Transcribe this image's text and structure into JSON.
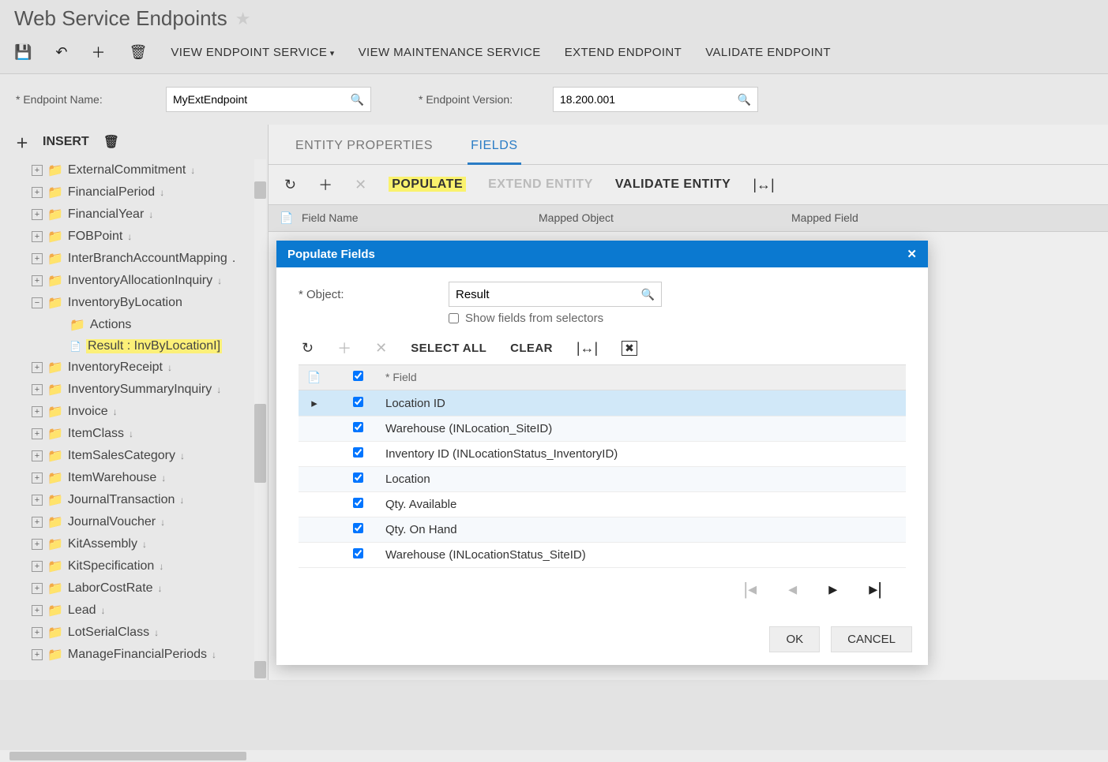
{
  "header": {
    "title": "Web Service Endpoints"
  },
  "toolbar": {
    "viewEndpointService": "VIEW ENDPOINT SERVICE",
    "viewMaintenanceService": "VIEW MAINTENANCE SERVICE",
    "extendEndpoint": "EXTEND ENDPOINT",
    "validateEndpoint": "VALIDATE ENDPOINT"
  },
  "form": {
    "endpointNameLabel": "* Endpoint Name:",
    "endpointName": "MyExtEndpoint",
    "endpointVersionLabel": "* Endpoint Version:",
    "endpointVersion": "18.200.001"
  },
  "leftPanel": {
    "insert": "INSERT",
    "tree": [
      {
        "label": "ExternalCommitment",
        "exp": "+",
        "arrow": true
      },
      {
        "label": "FinancialPeriod",
        "exp": "+",
        "arrow": true
      },
      {
        "label": "FinancialYear",
        "exp": "+",
        "arrow": true
      },
      {
        "label": "FOBPoint",
        "exp": "+",
        "arrow": true
      },
      {
        "label": "InterBranchAccountMapping",
        "exp": "+",
        "arrow": false,
        "ellipsis": true
      },
      {
        "label": "InventoryAllocationInquiry",
        "exp": "+",
        "arrow": true
      },
      {
        "label": "InventoryByLocation",
        "exp": "−",
        "arrow": false,
        "children": [
          {
            "label": "Actions",
            "icon": "folder"
          },
          {
            "label": "Result : InvByLocationI]",
            "icon": "doc",
            "highlight": true
          }
        ]
      },
      {
        "label": "InventoryReceipt",
        "exp": "+",
        "arrow": true
      },
      {
        "label": "InventorySummaryInquiry",
        "exp": "+",
        "arrow": true
      },
      {
        "label": "Invoice",
        "exp": "+",
        "arrow": true
      },
      {
        "label": "ItemClass",
        "exp": "+",
        "arrow": true
      },
      {
        "label": "ItemSalesCategory",
        "exp": "+",
        "arrow": true
      },
      {
        "label": "ItemWarehouse",
        "exp": "+",
        "arrow": true
      },
      {
        "label": "JournalTransaction",
        "exp": "+",
        "arrow": true
      },
      {
        "label": "JournalVoucher",
        "exp": "+",
        "arrow": true
      },
      {
        "label": "KitAssembly",
        "exp": "+",
        "arrow": true
      },
      {
        "label": "KitSpecification",
        "exp": "+",
        "arrow": true
      },
      {
        "label": "LaborCostRate",
        "exp": "+",
        "arrow": true
      },
      {
        "label": "Lead",
        "exp": "+",
        "arrow": true
      },
      {
        "label": "LotSerialClass",
        "exp": "+",
        "arrow": true
      },
      {
        "label": "ManageFinancialPeriods",
        "exp": "+",
        "arrow": true
      }
    ]
  },
  "tabs": {
    "entityProperties": "ENTITY PROPERTIES",
    "fields": "FIELDS"
  },
  "subToolbar": {
    "populate": "POPULATE",
    "extendEntity": "EXTEND ENTITY",
    "validateEntity": "VALIDATE ENTITY"
  },
  "gridHeaders": {
    "fieldName": "Field Name",
    "mappedObject": "Mapped Object",
    "mappedField": "Mapped Field"
  },
  "modal": {
    "title": "Populate Fields",
    "objectLabel": "* Object:",
    "object": "Result",
    "showFields": "Show fields from selectors",
    "selectAll": "SELECT ALL",
    "clear": "CLEAR",
    "fieldHeader": "* Field",
    "rows": [
      {
        "field": "Location ID",
        "checked": true,
        "selected": true
      },
      {
        "field": "Warehouse (INLocation_SiteID)",
        "checked": true
      },
      {
        "field": "Inventory ID (INLocationStatus_InventoryID)",
        "checked": true
      },
      {
        "field": "Location",
        "checked": true
      },
      {
        "field": "Qty. Available",
        "checked": true
      },
      {
        "field": "Qty. On Hand",
        "checked": true
      },
      {
        "field": "Warehouse (INLocationStatus_SiteID)",
        "checked": true
      }
    ],
    "ok": "OK",
    "cancel": "CANCEL"
  }
}
